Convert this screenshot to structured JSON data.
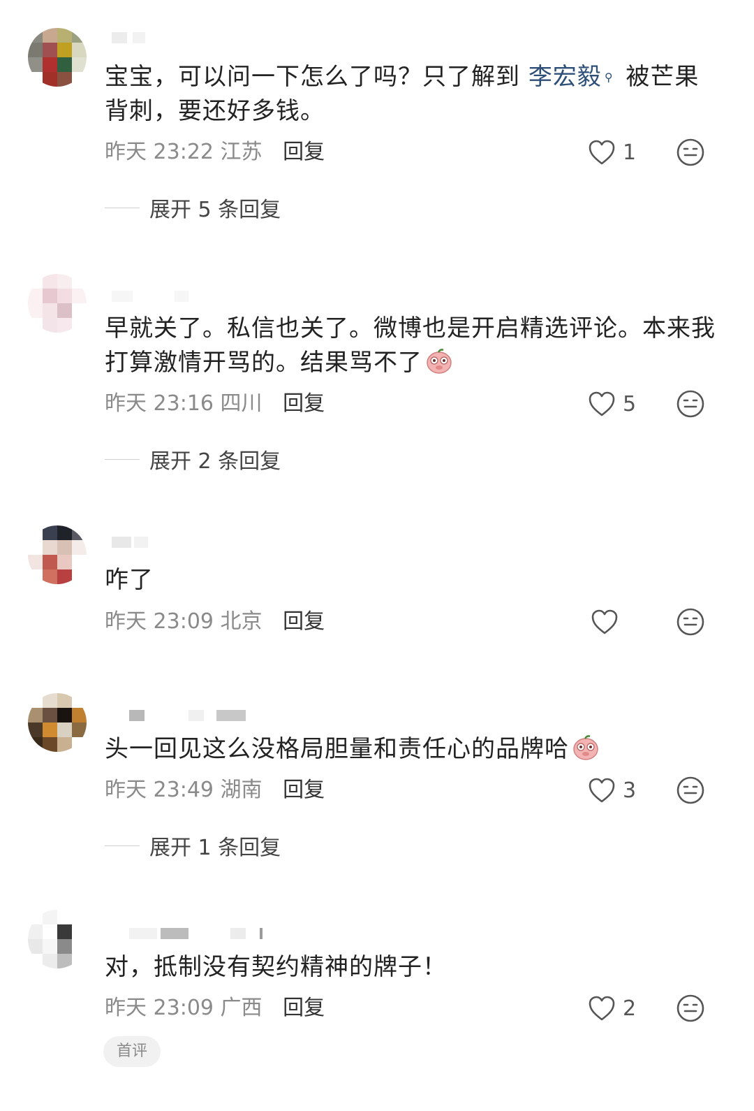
{
  "comments": [
    {
      "text_parts": [
        "宝宝，可以问一下怎么了吗？只了解到 ",
        "李宏毅",
        " 被芒果背刺，要还好多钱。"
      ],
      "time": "昨天 23:22",
      "location": "江苏",
      "reply_label": "回复",
      "likes": "1",
      "expand_label": "展开 5 条回复"
    },
    {
      "text": "早就关了。私信也关了。微博也是开启精选评论。本来我打算激情开骂的。结果骂不了",
      "emoji": "pig-face-emoji",
      "time": "昨天 23:16",
      "location": "四川",
      "reply_label": "回复",
      "likes": "5",
      "expand_label": "展开 2 条回复"
    },
    {
      "text": "咋了",
      "time": "昨天 23:09",
      "location": "北京",
      "reply_label": "回复",
      "likes": ""
    },
    {
      "text": "头一回见这么没格局胆量和责任心的品牌哈",
      "emoji": "pig-face-emoji",
      "time": "昨天 23:49",
      "location": "湖南",
      "reply_label": "回复",
      "likes": "3",
      "expand_label": "展开 1 条回复"
    },
    {
      "text": "对，抵制没有契约精神的牌子！",
      "time": "昨天 23:09",
      "location": "广西",
      "reply_label": "回复",
      "likes": "2"
    }
  ],
  "badge": "首评",
  "icons": {
    "like": "heart-outline-icon",
    "emoji_react": "face-emoji-icon",
    "search_hint": "search-hint-icon"
  },
  "colors": {
    "text": "#222222",
    "meta": "#8a8a8a",
    "link": "#2d4f78",
    "badge_bg": "#f1f1f1"
  }
}
